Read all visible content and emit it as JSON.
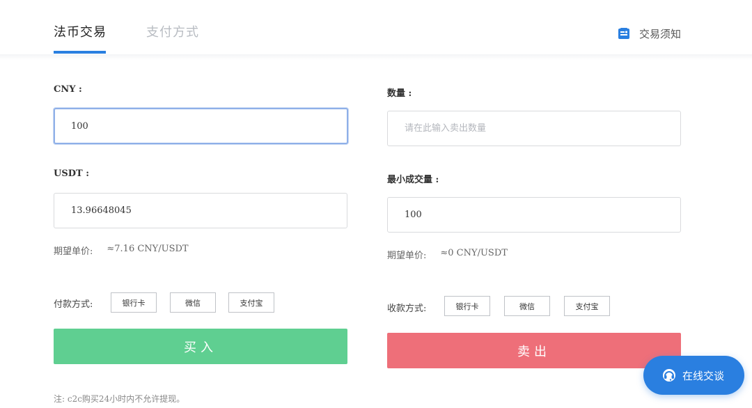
{
  "header": {
    "tabs": [
      {
        "label": "法币交易",
        "active": true
      },
      {
        "label": "支付方式",
        "active": false
      }
    ],
    "notice": {
      "label": "交易须知",
      "icon": "notice-card-icon"
    }
  },
  "buy": {
    "cny_label": "CNY :",
    "cny_value": "100",
    "usdt_label": "USDT :",
    "usdt_value": "13.96648045",
    "price_label": "期望单价:",
    "price_value": "≈7.16 CNY/USDT",
    "payment_label": "付款方式:",
    "payment_options": [
      "银行卡",
      "微信",
      "支付宝"
    ],
    "button_label": "买入"
  },
  "sell": {
    "quantity_label": "数量 :",
    "quantity_placeholder": "请在此输入卖出数量",
    "min_label": "最小成交量 :",
    "min_value": "100",
    "price_label": "期望单价:",
    "price_value": "≈0 CNY/USDT",
    "payment_label": "收款方式:",
    "payment_options": [
      "银行卡",
      "微信",
      "支付宝"
    ],
    "button_label": "卖出"
  },
  "note": "注: c2c购买24小时内不允许提现。",
  "chat": {
    "label": "在线交谈",
    "icon": "headset-icon"
  },
  "colors": {
    "accent": "#2a7fe0",
    "buy": "#5fcf91",
    "sell": "#ee6f79",
    "focus_border": "#8fb0e8"
  }
}
